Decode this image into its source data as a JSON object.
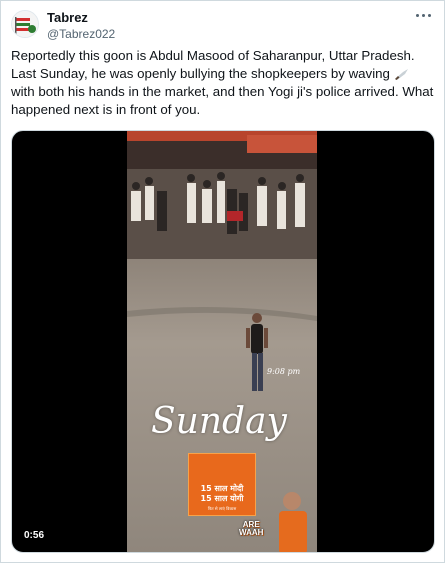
{
  "tweet": {
    "display_name": "Tabrez",
    "handle": "@Tabrez022",
    "text_part1": "Reportedly this goon is Abdul Masood of Saharanpur, Uttar Pradesh. Last Sunday, he was openly bullying the shopkeepers by waving ",
    "knife_emoji": "knife-icon",
    "text_part2": " with both his hands in the market, and then Yogi ji's police arrived. What happened next is in front of you."
  },
  "video": {
    "duration": "0:56",
    "overlay_time": "9:08 pm",
    "overlay_title": "Sunday",
    "poster_line1": "15 साल मोदी",
    "poster_line2": "15 साल योगी",
    "poster_line3": "फिर से लाएं विकास",
    "sticker_text": "ARE\nWAAH"
  },
  "colors": {
    "text_primary": "#0f1419",
    "text_secondary": "#536471",
    "border": "#cfd9de",
    "poster_orange": "#e8691c"
  }
}
